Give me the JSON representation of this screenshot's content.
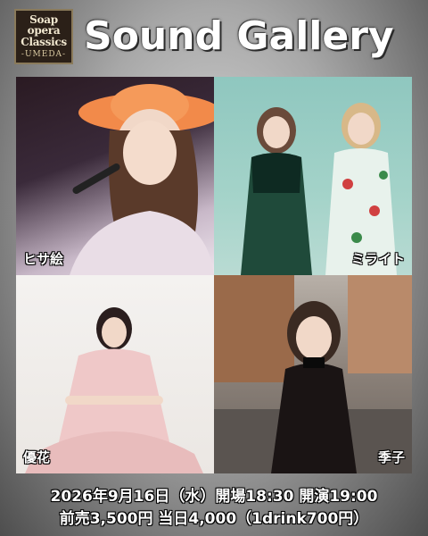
{
  "logo": {
    "line1": "Soap",
    "line2": "opera",
    "line3": "Classics",
    "line4": "-UMEDA-"
  },
  "title": "Sound Gallery",
  "performers": [
    {
      "name": "ヒサ絵"
    },
    {
      "name": "ミライト"
    },
    {
      "name": "優花"
    },
    {
      "name": "季子"
    }
  ],
  "footer": {
    "line1": "2026年9月16日（水）開場18:30 開演19:00",
    "line2": "前売3,500円 当日4,000（1drink700円）"
  }
}
